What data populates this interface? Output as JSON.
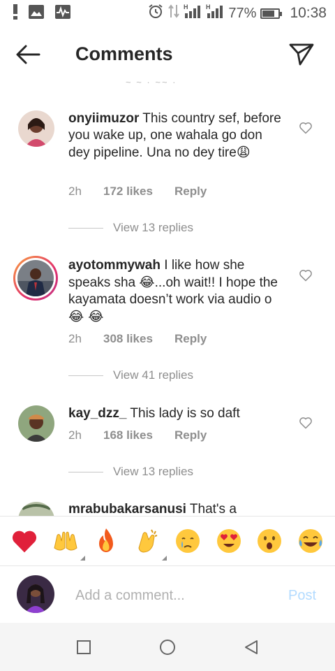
{
  "status_bar": {
    "battery_text": "77%",
    "battery_level": 0.77,
    "time": "10:38",
    "network_1": "H",
    "network_2": "H"
  },
  "header": {
    "title": "Comments"
  },
  "comments": [
    {
      "username": "onyiimuzor",
      "text": "This country sef, before you wake up, one wahala go don dey pipeline. Una no dey tire",
      "emoji": "😩",
      "time": "2h",
      "likes": "172 likes",
      "reply": "Reply",
      "view_replies": "View 13 replies"
    },
    {
      "username": "ayotommywah",
      "text_1": "I like how she speaks sha ",
      "emoji_1": "😂",
      "text_2": "...oh wait!! I hope the kayamata doesn’t work via audio o ",
      "emoji_2": "😂 😂",
      "time": "2h",
      "likes": "308 likes",
      "reply": "Reply",
      "view_replies": "View 41 replies"
    },
    {
      "username": "kay_dzz_",
      "text": "This lady is so daft",
      "time": "2h",
      "likes": "168 likes",
      "reply": "Reply",
      "view_replies": "View 13 replies"
    },
    {
      "username": "mrabubakarsanusi",
      "text": "That's a"
    }
  ],
  "emoji_bar": [
    "❤️",
    "🙌",
    "🔥",
    "👏",
    "😢",
    "😍",
    "😮",
    "😂"
  ],
  "add_comment": {
    "placeholder": "Add a comment...",
    "post_label": "Post"
  },
  "colors": {
    "text": "#262626",
    "secondary": "#8e8e8e",
    "post_disabled": "#b3dbff",
    "heart_red": "#ed4956"
  }
}
